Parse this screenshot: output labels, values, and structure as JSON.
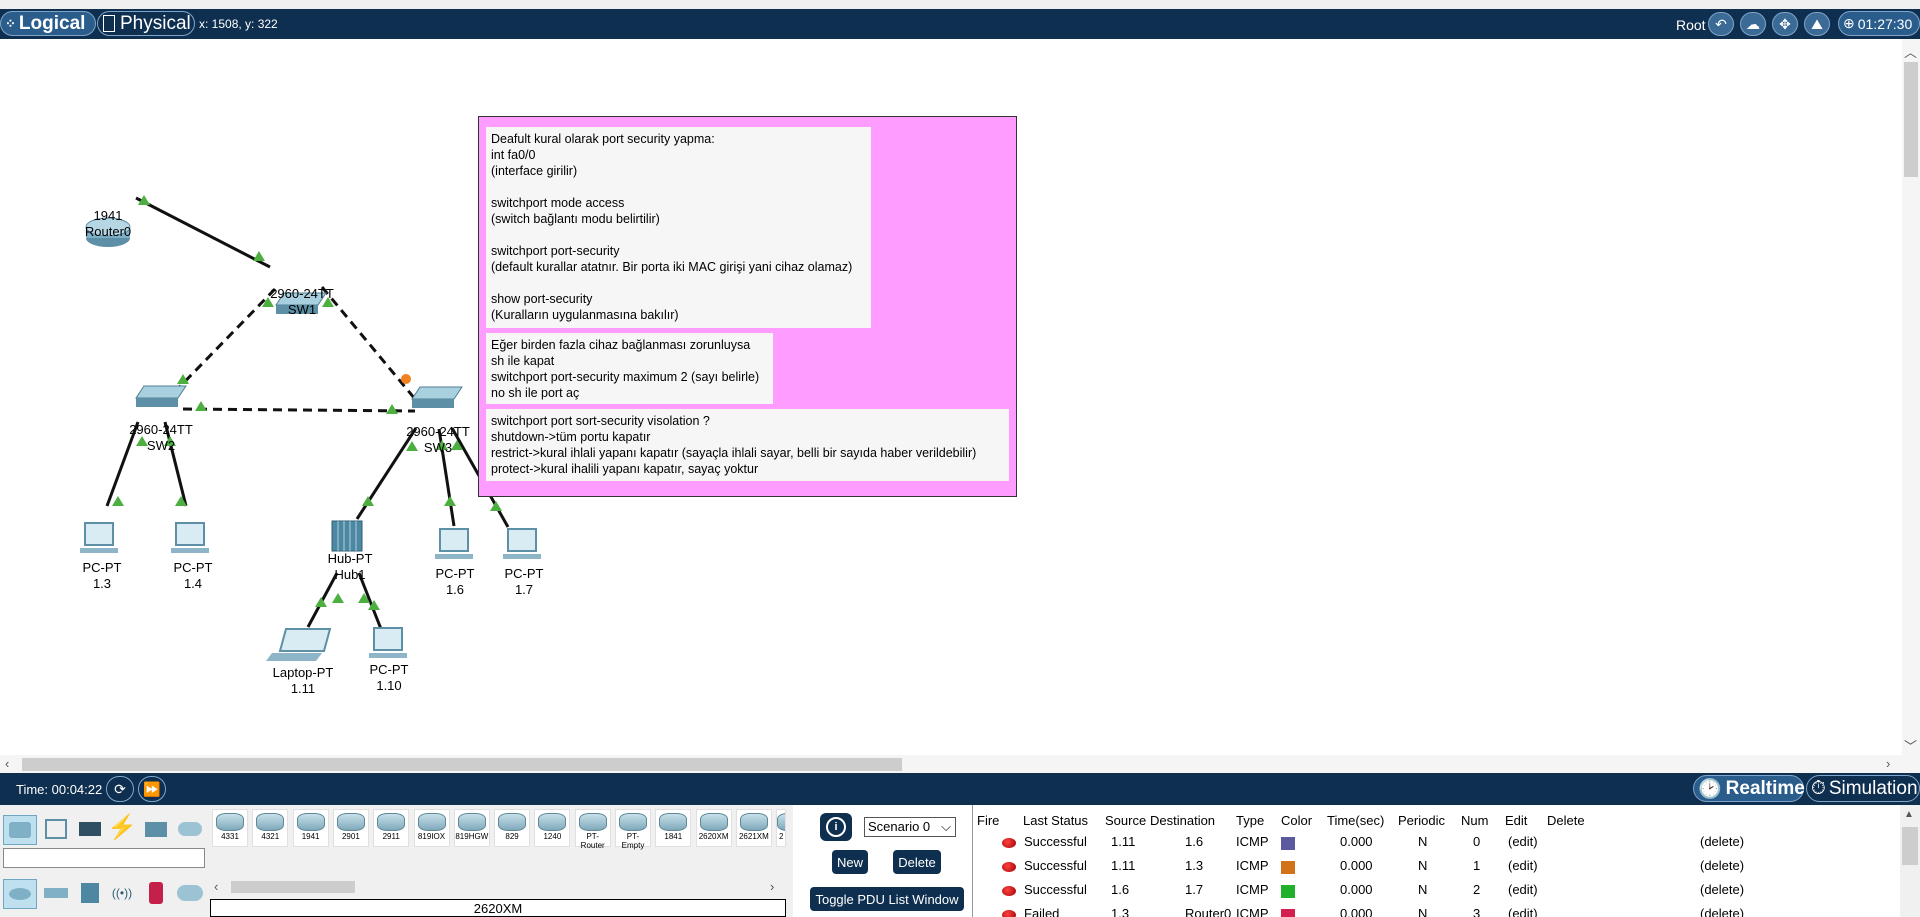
{
  "topbar": {
    "logical_label": "Logical",
    "physical_label": "Physical",
    "coords": "x: 1508, y: 322",
    "root_label": "Root",
    "clock": "01:27:30"
  },
  "notes": [
    "Deafult kural olarak port security yapma:\nint fa0/0\n(interface girilir)\n\nswitchport mode access\n(switch bağlantı modu belirtilir)\n\nswitchport port-security\n(default kurallar atatnır. Bir porta iki MAC girişi yani cihaz olamaz)\n\nshow port-security\n(Kuralların uygulanmasına bakılır)",
    "Eğer birden fazla cihaz bağlanması zorunluysa\nsh ile kapat\nswitchport port-security maximum 2 (sayı belirle)\nno sh ile port aç",
    "switchport port sort-security visolation ?\nshutdown->tüm portu kapatır\nrestrict->kural ihlali yapanı kapatır (sayaçla ihlali sayar, belli bir sayıda haber verildebilir)\nprotect->kural ihalili yapanı kapatır, sayaç yoktur"
  ],
  "devices": {
    "router0": {
      "model": "1941",
      "name": "Router0"
    },
    "sw1": {
      "model": "2960-24TT",
      "name": "SW1"
    },
    "sw2": {
      "model": "2960-24TT",
      "name": "SW2"
    },
    "sw3": {
      "model": "2960-24TT",
      "name": "SW3"
    },
    "hub1": {
      "model": "Hub-PT",
      "name": "Hub1"
    },
    "pc13": {
      "model": "PC-PT",
      "name": "1.3"
    },
    "pc14": {
      "model": "PC-PT",
      "name": "1.4"
    },
    "pc16": {
      "model": "PC-PT",
      "name": "1.6"
    },
    "pc17": {
      "model": "PC-PT",
      "name": "1.7"
    },
    "laptop111": {
      "model": "Laptop-PT",
      "name": "1.11"
    },
    "pc110": {
      "model": "PC-PT",
      "name": "1.10"
    }
  },
  "timebar": {
    "time": "Time: 00:04:22",
    "realtime_label": "Realtime",
    "simulation_label": "Simulation"
  },
  "device_list": [
    "4331",
    "4321",
    "1941",
    "2901",
    "2911",
    "819IOX",
    "819HGW",
    "829",
    "1240",
    "PT-Router",
    "PT-Empty",
    "1841",
    "2620XM",
    "2621XM",
    "2"
  ],
  "selected_model": "2620XM",
  "scenario": {
    "select_value": "Scenario 0",
    "new_label": "New",
    "delete_label": "Delete",
    "toggle_label": "Toggle PDU List Window"
  },
  "pdu_table": {
    "headers": [
      "Fire",
      "Last Status",
      "Source",
      "Destination",
      "Type",
      "Color",
      "Time(sec)",
      "Periodic",
      "Num",
      "Edit",
      "Delete"
    ],
    "rows": [
      {
        "status": "Successful",
        "source": "1.11",
        "destination": "1.6",
        "type": "ICMP",
        "color": "#5b5aa0",
        "time": "0.000",
        "periodic": "N",
        "num": "0",
        "edit": "(edit)",
        "delete": "(delete)"
      },
      {
        "status": "Successful",
        "source": "1.11",
        "destination": "1.3",
        "type": "ICMP",
        "color": "#d2731c",
        "time": "0.000",
        "periodic": "N",
        "num": "1",
        "edit": "(edit)",
        "delete": "(delete)"
      },
      {
        "status": "Successful",
        "source": "1.6",
        "destination": "1.7",
        "type": "ICMP",
        "color": "#22b02a",
        "time": "0.000",
        "periodic": "N",
        "num": "2",
        "edit": "(edit)",
        "delete": "(delete)"
      },
      {
        "status": "Failed",
        "source": "1.3",
        "destination": "Router0",
        "type": "ICMP",
        "color": "#d22050",
        "time": "0.000",
        "periodic": "N",
        "num": "3",
        "edit": "(edit)",
        "delete": "(delete)"
      }
    ]
  }
}
